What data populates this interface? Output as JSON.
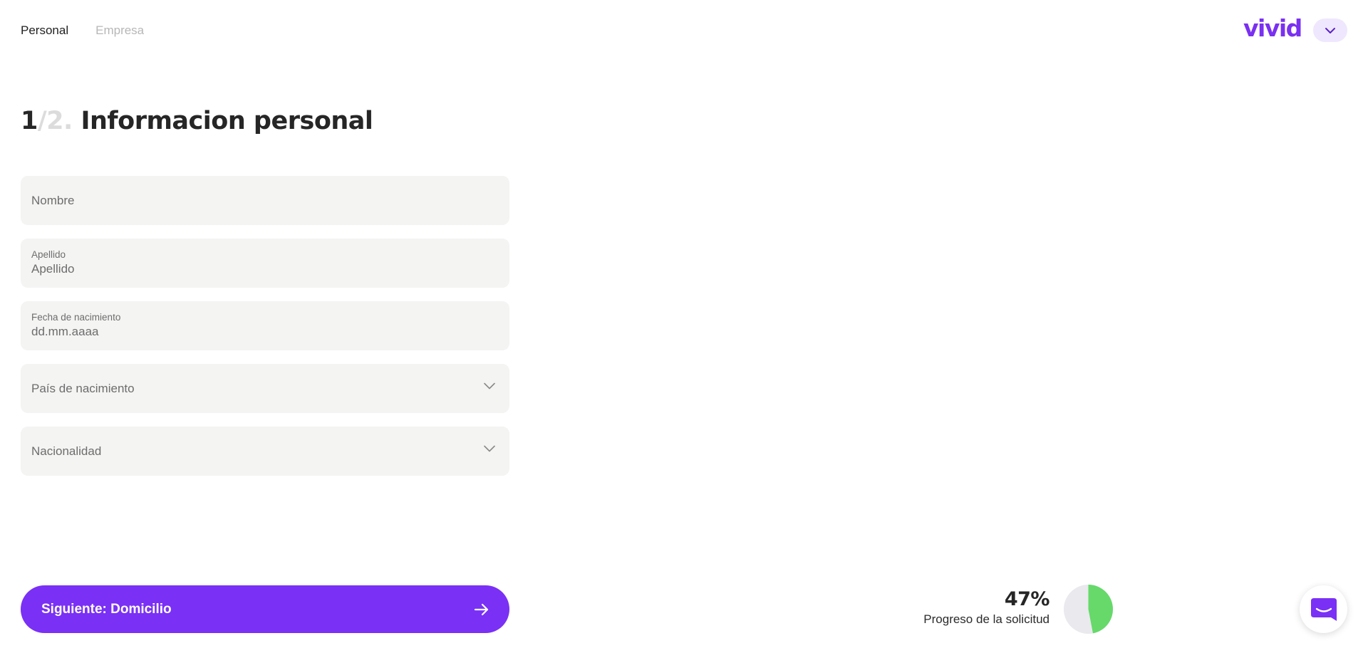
{
  "nav": {
    "tabs": [
      {
        "label": "Personal"
      },
      {
        "label": "Empresa"
      }
    ]
  },
  "brand": {
    "logo_text": "vivid",
    "accent_color": "#7a30f5"
  },
  "header": {
    "language_toggle_icon": "chevron-down-icon"
  },
  "page": {
    "step_current": "1",
    "step_total": "/2.",
    "title": "Informacion personal"
  },
  "form": {
    "nombre": {
      "placeholder": "Nombre"
    },
    "apellido": {
      "label": "Apellido",
      "placeholder": "Apellido"
    },
    "fecha": {
      "label": "Fecha de nacimiento",
      "placeholder": "dd.mm.aaaa"
    },
    "pais": {
      "placeholder": "País de nacimiento"
    },
    "nacionalidad": {
      "placeholder": "Nacionalidad"
    }
  },
  "actions": {
    "next_label": "Siguiente: Domicilio"
  },
  "progress": {
    "percent_text": "47%",
    "value": 0.47,
    "label": "Progreso de la solicitud",
    "fill_color": "#66d96a",
    "track_color": "#e9e9ee"
  },
  "chat": {
    "icon": "chat-bubble-icon"
  }
}
